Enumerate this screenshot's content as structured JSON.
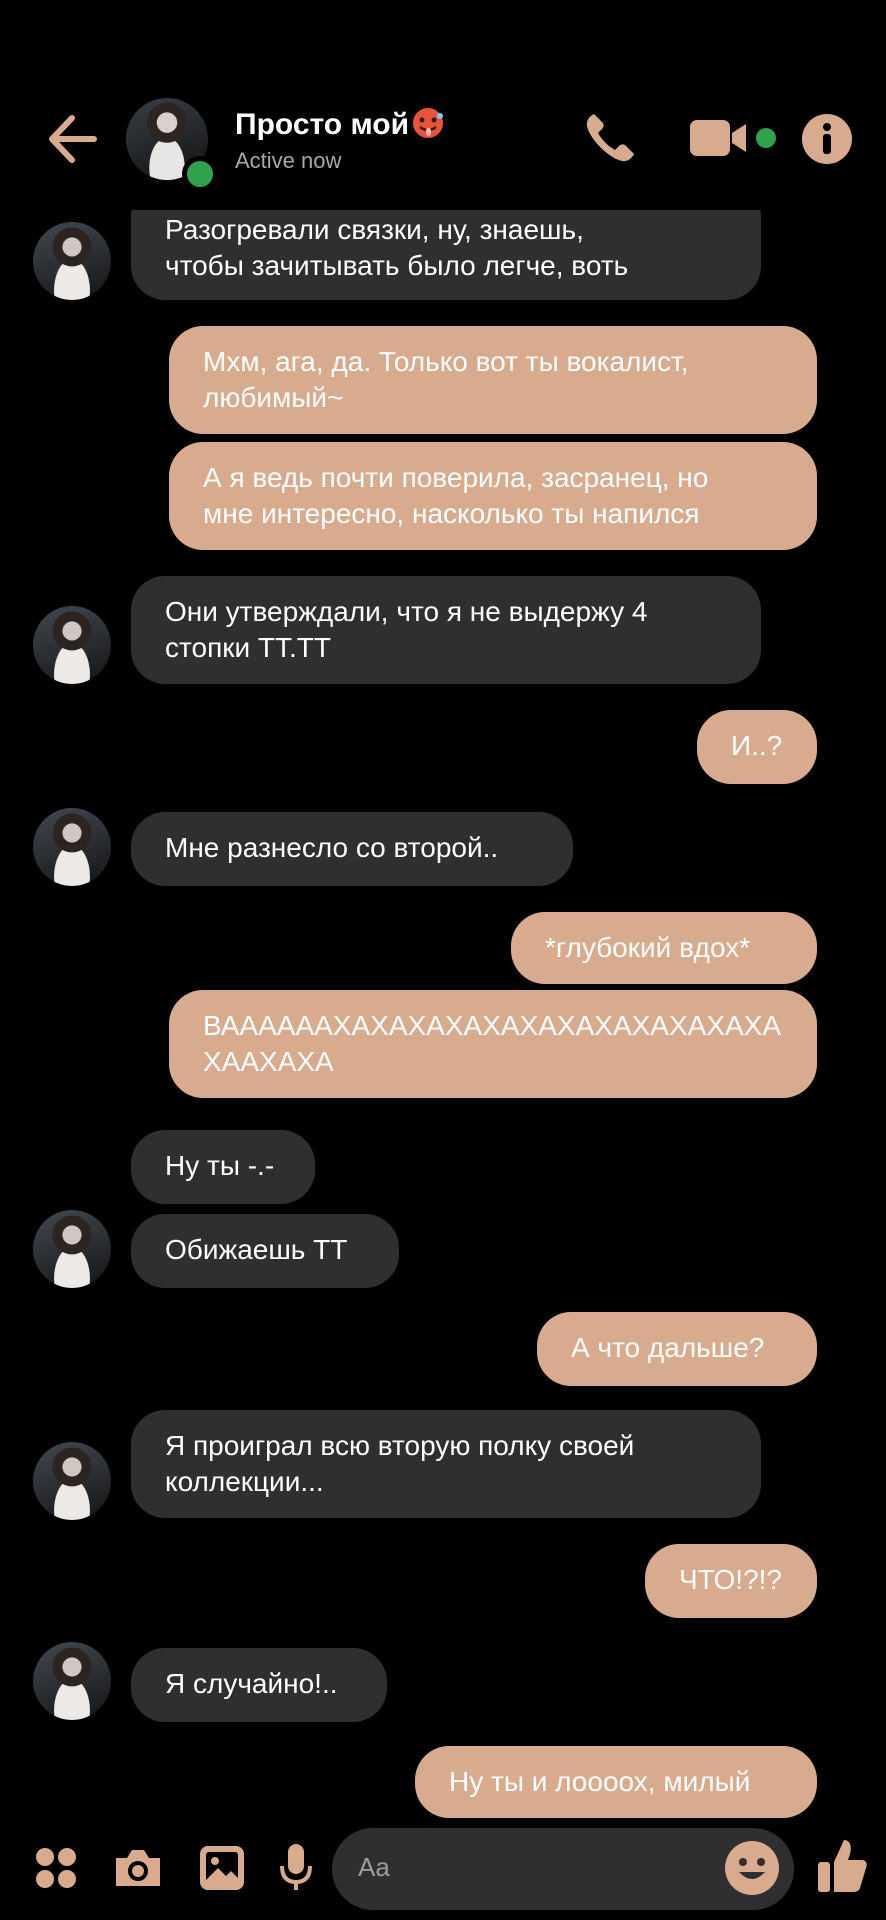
{
  "header": {
    "contact_name": "Просто мой",
    "status": "Active now"
  },
  "messages": [
    {
      "side": "in",
      "text": "Разогревали связки, ну, знаешь,\nчтобы зачитывать было легче, воть"
    },
    {
      "side": "out",
      "text": "Мхм, ага, да. Только вот ты вокалист,\nлюбимый~"
    },
    {
      "side": "out",
      "text": "А я ведь почти поверила, засранец, но\nмне интересно, насколько ты напился"
    },
    {
      "side": "in",
      "text": "Они утверждали, что я не выдержу 4\nстопки ТТ.ТТ"
    },
    {
      "side": "out",
      "text": "И..?"
    },
    {
      "side": "in",
      "text": "Мне разнесло со второй.."
    },
    {
      "side": "out",
      "text": "*глубокий вдох*"
    },
    {
      "side": "out",
      "text": "ВААААААХАХАХАХАХАХАХАХАХАХАХАХА\nХААХАХА"
    },
    {
      "side": "in",
      "text": "Ну ты -.-"
    },
    {
      "side": "in",
      "text": "Обижаешь ТТ"
    },
    {
      "side": "out",
      "text": "А что дальше?"
    },
    {
      "side": "in",
      "text": "Я проиграл всю вторую полку своей\nколлекции..."
    },
    {
      "side": "out",
      "text": "ЧТО!?!?"
    },
    {
      "side": "in",
      "text": "Я случайно!.."
    },
    {
      "side": "out",
      "text": "Ну ты и лоооох, милый"
    }
  ],
  "composer": {
    "placeholder": "Aa"
  },
  "icons": {
    "back": "arrow-left-icon",
    "call": "phone-icon",
    "video": "video-camera-icon",
    "info": "info-icon",
    "menu": "four-dots-icon",
    "camera": "camera-icon",
    "gallery": "image-icon",
    "mic": "microphone-icon",
    "emoji": "smile-icon",
    "like": "thumbs-up-icon"
  },
  "colors": {
    "accent": "#d9ab8e",
    "incoming_bubble": "#2f2e30",
    "online": "#31a24c",
    "background": "#000000"
  }
}
